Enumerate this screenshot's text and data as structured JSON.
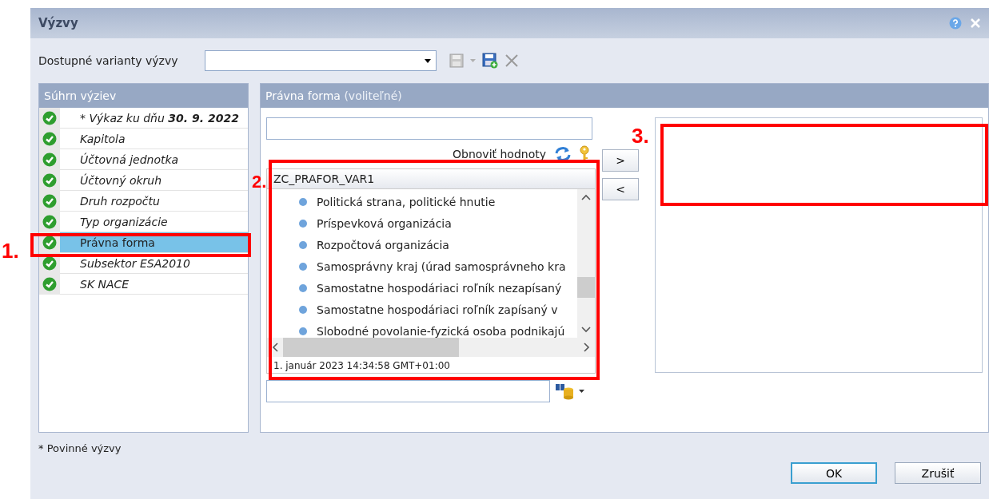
{
  "window": {
    "title": "Výzvy"
  },
  "variants": {
    "label": "Dostupné varianty výzvy"
  },
  "summary": {
    "title": "Súhrn výziev",
    "items": [
      {
        "label": "* Výkaz ku dňu **30. 9. 2022**",
        "selected": false
      },
      {
        "label": "Kapitola",
        "selected": false
      },
      {
        "label": "Účtovná jednotka",
        "selected": false
      },
      {
        "label": "Účtovný okruh",
        "selected": false
      },
      {
        "label": "Druh rozpočtu",
        "selected": false
      },
      {
        "label": "Typ organizácie",
        "selected": false
      },
      {
        "label": "Právna forma",
        "selected": true
      },
      {
        "label": "Subsektor ESA2010",
        "selected": false
      },
      {
        "label": "SK NACE",
        "selected": false
      }
    ]
  },
  "detail": {
    "title": "Právna forma",
    "hint": "(voliteľné)",
    "refresh_label": "Obnoviť hodnoty",
    "list_header": "ZC_PRAFOR_VAR1",
    "values": [
      "Politická strana, politické hnutie",
      "Príspevková organizácia",
      "Rozpočtová organizácia",
      "Samosprávny kraj (úrad samosprávneho kra",
      "Samostatne hospodáriaci roľník nezapísaný",
      "Samostatne hospodáriaci roľník zapísaný v",
      "Slobodné povolanie-fyzická osoba podnikajú"
    ],
    "timestamp": "1. január 2023 14:34:58 GMT+01:00",
    "add_button": ">",
    "remove_button": "<"
  },
  "footnote": "* Povinné výzvy",
  "buttons": [
    "OK",
    "Zrušiť"
  ],
  "annotations": [
    "1.",
    "2.",
    "3."
  ]
}
